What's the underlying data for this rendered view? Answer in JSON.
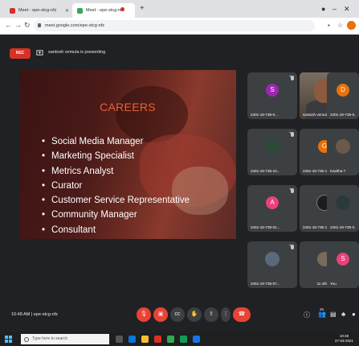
{
  "browser": {
    "tabs": [
      {
        "label": "Meet - epe-stcg-nfz",
        "active": false,
        "favicon_color": "#d93025"
      },
      {
        "label": "Meet - epe-stcg-nfz",
        "active": true,
        "favicon_color": "#34a853"
      }
    ],
    "url": "meet.google.com/epe-stcg-nfz"
  },
  "meeting": {
    "rec_label": "REC",
    "presenting_text": "santosh vemula is presenting",
    "time_code": "10:48 AM | epe-stcg-nfz"
  },
  "slide": {
    "title": "CAREERS",
    "items": [
      "Social Media Manager",
      "Marketing Specialist",
      "Metrics Analyst",
      "Curator",
      "Customer Service Representative",
      "Community Manager",
      "Consultant"
    ]
  },
  "participants": [
    {
      "name": "2401-19-735-0...",
      "initial": "S",
      "color": "#9c27b0",
      "type": "initial"
    },
    {
      "name": "santosh vemula",
      "initial": "",
      "color": "",
      "type": "photo"
    },
    {
      "name": "2401-19-735-0...",
      "initial": "D",
      "color": "#e8710a",
      "type": "initial"
    },
    {
      "name": "2451-19-735-10...",
      "initial": "",
      "color": "#2e4a3a",
      "type": "image"
    },
    {
      "name": "2451-19-735-10...",
      "initial": "G",
      "color": "#e8710a",
      "type": "initial"
    },
    {
      "name": "Kavitha T",
      "initial": "",
      "color": "#6b5a4a",
      "type": "image"
    },
    {
      "name": "2451-18-735-01...",
      "initial": "A",
      "color": "#ec407a",
      "type": "initial"
    },
    {
      "name": "2451-19-735-10...",
      "initial": "",
      "color": "#1d1d1d",
      "type": "image"
    },
    {
      "name": "2451-19-735-0...",
      "initial": "",
      "color": "#2a3a3a",
      "type": "image"
    },
    {
      "name": "2451-19-735-07...",
      "initial": "",
      "color": "#5a6a7a",
      "type": "image"
    },
    {
      "name": "11 others",
      "initial": "",
      "color": "#7a6a5a",
      "type": "image"
    },
    {
      "name": "You",
      "initial": "S",
      "color": "#ec407a",
      "type": "initial"
    }
  ],
  "controls": {
    "mic": "mic-off",
    "camera": "camera-off",
    "captions": "captions",
    "hand": "raise-hand",
    "present": "present",
    "more": "more",
    "hangup": "hang-up"
  },
  "right_controls": {
    "participant_count": "26"
  },
  "taskbar": {
    "search_placeholder": "Type here to search",
    "clock_time": "10:48",
    "clock_date": "27-03-2021"
  }
}
